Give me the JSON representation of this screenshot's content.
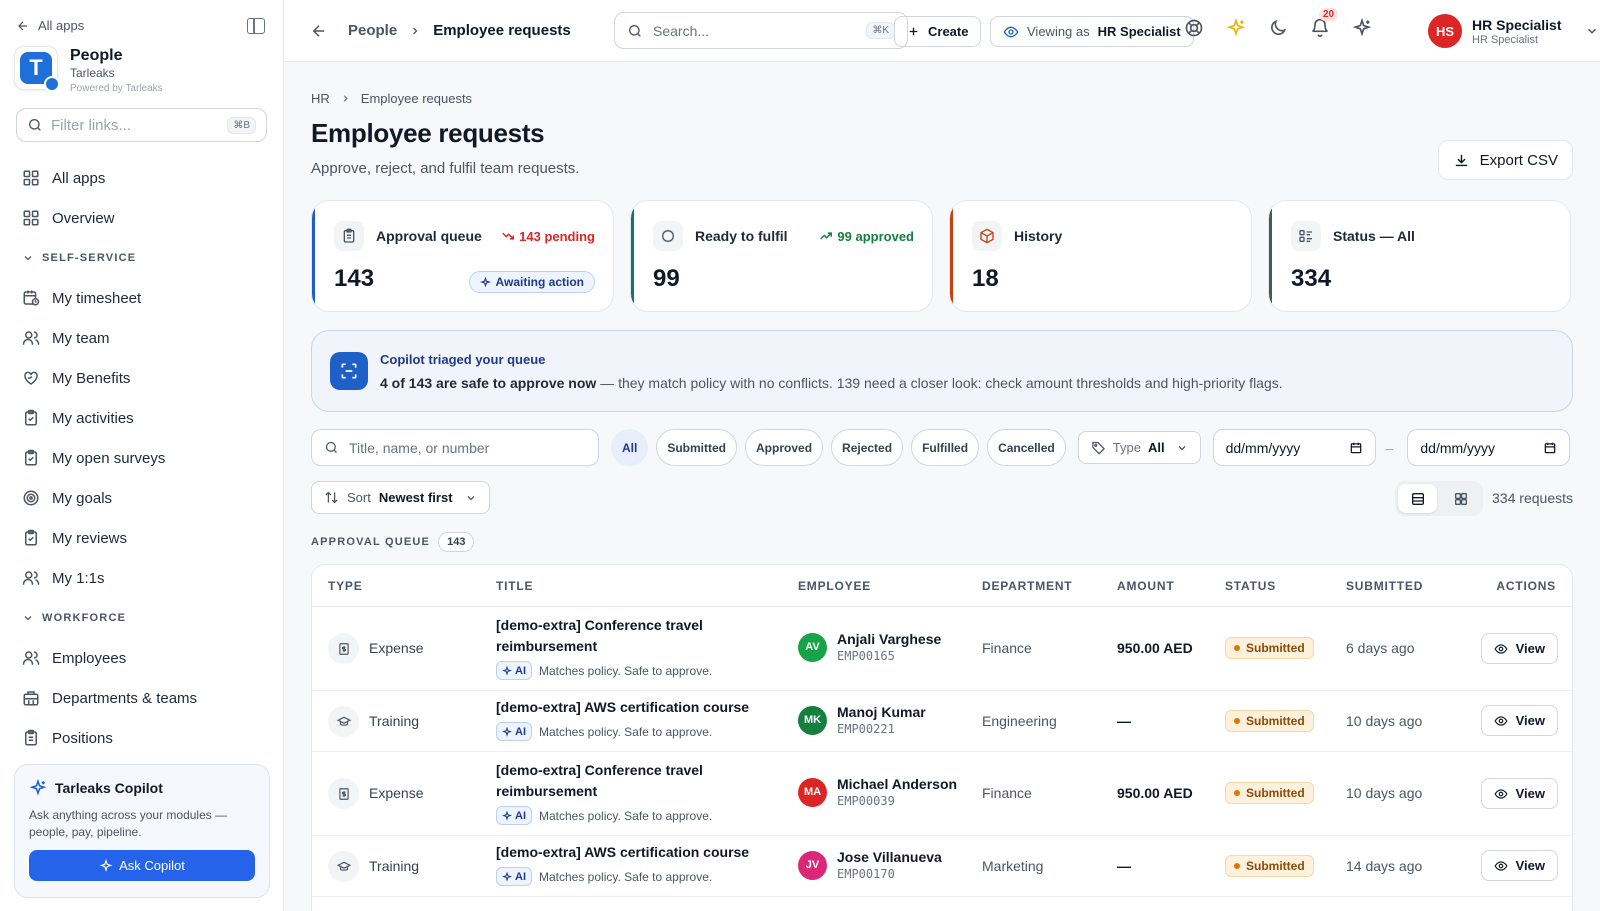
{
  "sidebar": {
    "all_apps": "All apps",
    "brand": {
      "name": "People",
      "org": "Tarleaks",
      "powered": "Powered by Tarleaks",
      "logo_letter": "T"
    },
    "filter": {
      "placeholder": "Filter links...",
      "shortcut": "⌘B"
    },
    "top_items": [
      {
        "label": "All apps",
        "icon": "grid-icon"
      },
      {
        "label": "Overview",
        "icon": "grid-icon"
      }
    ],
    "section_self": "SELF-SERVICE",
    "self_items": [
      {
        "label": "My timesheet",
        "icon": "calendar-clock-icon"
      },
      {
        "label": "My team",
        "icon": "users-icon"
      },
      {
        "label": "My Benefits",
        "icon": "heart-hand-icon"
      },
      {
        "label": "My activities",
        "icon": "clipboard-check-icon"
      },
      {
        "label": "My open surveys",
        "icon": "clipboard-check-icon"
      },
      {
        "label": "My goals",
        "icon": "target-icon"
      },
      {
        "label": "My reviews",
        "icon": "clipboard-check-icon"
      },
      {
        "label": "My 1:1s",
        "icon": "users-icon"
      }
    ],
    "section_workforce": "WORKFORCE",
    "workforce_items": [
      {
        "label": "Employees",
        "icon": "users-icon"
      },
      {
        "label": "Departments & teams",
        "icon": "building-icon"
      },
      {
        "label": "Positions",
        "icon": "clipboard-icon"
      }
    ],
    "copilot": {
      "title": "Tarleaks Copilot",
      "desc": "Ask anything across your modules — people, pay, pipeline.",
      "button": "Ask Copilot"
    }
  },
  "topbar": {
    "crumb_parent": "People",
    "crumb_current": "Employee requests",
    "search_placeholder": "Search...",
    "search_shortcut": "⌘K",
    "create_label": "Create",
    "viewing_prefix": "Viewing as",
    "viewing_role": "HR Specialist",
    "notifications_count": "20",
    "user": {
      "initials": "HS",
      "name": "HR Specialist",
      "role": "HR Specialist"
    }
  },
  "page": {
    "crumb_root": "HR",
    "crumb_current": "Employee requests",
    "title": "Employee requests",
    "subtitle": "Approve, reject, and fulfil team requests.",
    "export_label": "Export CSV"
  },
  "stats": [
    {
      "label": "Approval queue",
      "value": "143",
      "trend": "143 pending",
      "pill": "Awaiting action"
    },
    {
      "label": "Ready to fulfil",
      "value": "99",
      "trend": "99 approved"
    },
    {
      "label": "History",
      "value": "18"
    },
    {
      "label": "Status — All",
      "value": "334"
    }
  ],
  "copilot_banner": {
    "title": "Copilot triaged your queue",
    "bold": "4 of 143 are safe to approve now",
    "rest": " — they match policy with no conflicts. 139 need a closer look: check amount thresholds and high-priority flags."
  },
  "filters": {
    "search_placeholder": "Title, name, or number",
    "chips": [
      "All",
      "Submitted",
      "Approved",
      "Rejected",
      "Fulfilled",
      "Cancelled"
    ],
    "active_chip": "All",
    "type_label": "Type",
    "type_value": "All",
    "date_from": "dd/mm/yyyy",
    "date_to": "dd/mm/yyyy",
    "date_sep": "–"
  },
  "sort": {
    "label": "Sort",
    "value": "Newest first"
  },
  "request_count": "334 requests",
  "queue": {
    "label": "APPROVAL QUEUE",
    "count": "143"
  },
  "table": {
    "headers": [
      "TYPE",
      "TITLE",
      "EMPLOYEE",
      "DEPARTMENT",
      "AMOUNT",
      "STATUS",
      "SUBMITTED",
      "ACTIONS"
    ],
    "ai_label": "AI",
    "view_label": "View",
    "rows": [
      {
        "type": "Expense",
        "title": "[demo-extra] Conference travel reimbursement",
        "ai_note": "Matches policy. Safe to approve.",
        "initials": "AV",
        "avatar_color": "#16a34a",
        "name": "Anjali Varghese",
        "emp_id": "EMP00165",
        "department": "Finance",
        "amount": "950.00 AED",
        "status": "Submitted",
        "submitted": "6 days ago"
      },
      {
        "type": "Training",
        "title": "[demo-extra] AWS certification course",
        "ai_note": "Matches policy. Safe to approve.",
        "initials": "MK",
        "avatar_color": "#15803d",
        "name": "Manoj Kumar",
        "emp_id": "EMP00221",
        "department": "Engineering",
        "amount": "—",
        "status": "Submitted",
        "submitted": "10 days ago"
      },
      {
        "type": "Expense",
        "title": "[demo-extra] Conference travel reimbursement",
        "ai_note": "Matches policy. Safe to approve.",
        "initials": "MA",
        "avatar_color": "#dc2626",
        "name": "Michael Anderson",
        "emp_id": "EMP00039",
        "department": "Finance",
        "amount": "950.00 AED",
        "status": "Submitted",
        "submitted": "10 days ago"
      },
      {
        "type": "Training",
        "title": "[demo-extra] AWS certification course",
        "ai_note": "Matches policy. Safe to approve.",
        "initials": "JV",
        "avatar_color": "#db2777",
        "name": "Jose Villanueva",
        "emp_id": "EMP00170",
        "department": "Marketing",
        "amount": "—",
        "status": "Submitted",
        "submitted": "14 days ago"
      }
    ]
  }
}
